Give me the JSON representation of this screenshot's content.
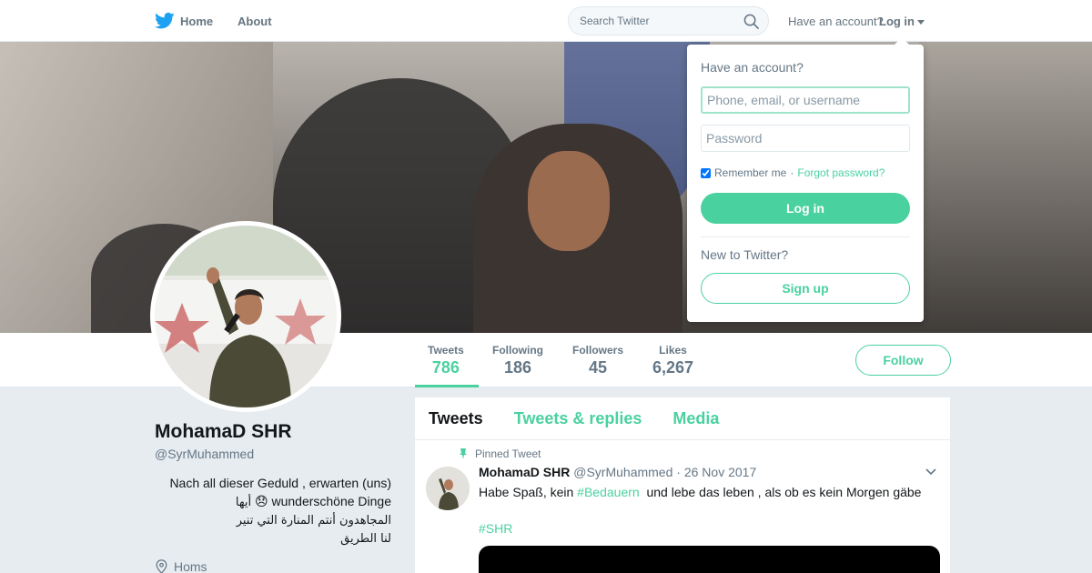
{
  "nav": {
    "home_label": "Home",
    "about_label": "About",
    "search_placeholder": "Search Twitter",
    "account_question": "Have an account?",
    "login_label": "Log in"
  },
  "profile": {
    "name": "MohamaD SHR",
    "handle": "@SyrMuhammed",
    "bio_line1": "Nach all dieser Geduld , erwarten (uns)",
    "bio_line2": "wunderschöne Dinge",
    "bio_emoji": "😞",
    "bio_line2_ar": "أيها",
    "bio_line3": "المجاهدون أنتم المنارة التي تنير",
    "bio_line4": "لنا الطريق",
    "location": "Homs"
  },
  "stats": [
    {
      "label": "Tweets",
      "value": "786"
    },
    {
      "label": "Following",
      "value": "186"
    },
    {
      "label": "Followers",
      "value": "45"
    },
    {
      "label": "Likes",
      "value": "6,267"
    }
  ],
  "follow_label": "Follow",
  "timeline": {
    "tabs": [
      "Tweets",
      "Tweets & replies",
      "Media"
    ],
    "pinned_label": "Pinned Tweet",
    "tweet": {
      "name": "MohamaD SHR",
      "handle": "@SyrMuhammed",
      "sep": "·",
      "date": "26 Nov 2017",
      "text_before": "Habe Spaß, kein ",
      "hashtag1": "#Bedauern",
      "text_after": "  und lebe das leben , als ob es kein Morgen gäbe ",
      "hashtag2": "#SHR"
    }
  },
  "login_dropdown": {
    "question": "Have an account?",
    "username_placeholder": "Phone, email, or username",
    "password_placeholder": "Password",
    "remember_label": "Remember me",
    "sep": "·",
    "forgot_label": "Forgot password?",
    "login_button": "Log in",
    "new_label": "New to Twitter?",
    "signup_button": "Sign up"
  },
  "colors": {
    "accent": "#4ad1a0",
    "text_secondary": "#657786",
    "background": "#e6ecf0"
  }
}
